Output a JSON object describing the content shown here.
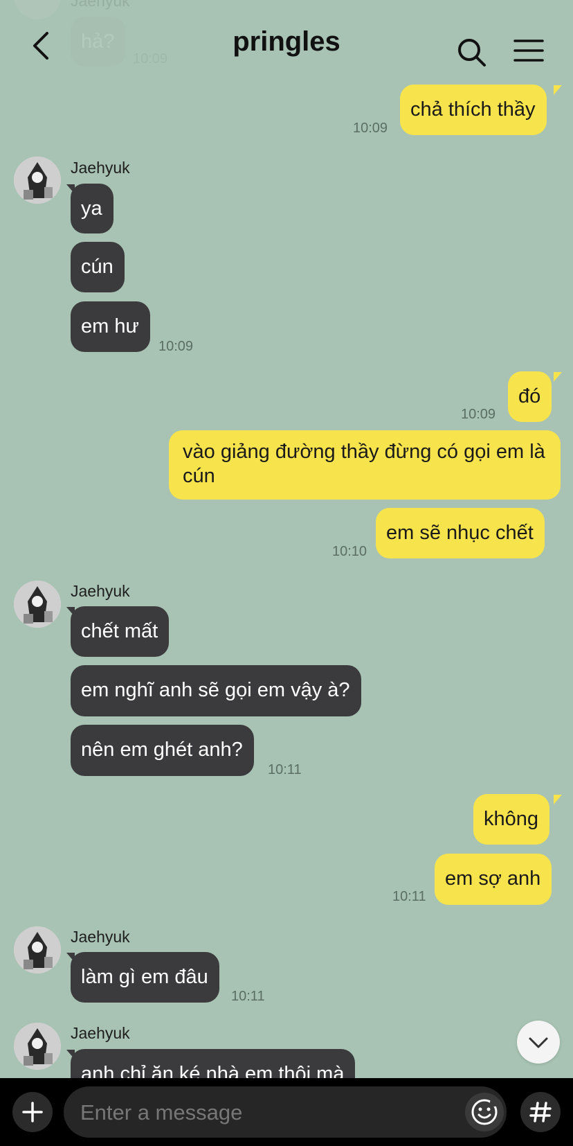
{
  "header": {
    "title": "pringles",
    "back_icon": "chevron-left-icon",
    "search_icon": "search-icon",
    "menu_icon": "hamburger-menu-icon"
  },
  "messages": {
    "faded_sender": "Jaehyuk",
    "faded_text": "hả?",
    "faded_time": "10:09",
    "m1": {
      "text": "chả thích thầy",
      "time": "10:09"
    },
    "g1": {
      "sender": "Jaehyuk",
      "a": "ya",
      "b": "cún",
      "c": "em hư",
      "time": "10:09"
    },
    "m2": {
      "a": "đó",
      "time_a": "10:09",
      "b": "vào giảng đường thầy đừng có gọi em là cún",
      "c": "em sẽ nhục chết",
      "time_c": "10:10"
    },
    "g2": {
      "sender": "Jaehyuk",
      "a": "chết mất",
      "b": "em nghĩ anh sẽ gọi em vậy à?",
      "c": "nên em ghét anh?",
      "time": "10:11"
    },
    "m3": {
      "a": "không",
      "b": "em sợ anh",
      "time": "10:11"
    },
    "g3": {
      "sender": "Jaehyuk",
      "a": "làm gì em đâu",
      "time": "10:11"
    },
    "g4": {
      "sender": "Jaehyuk",
      "a": "anh chỉ ăn ké nhà em thôi mà"
    }
  },
  "input": {
    "placeholder": "Enter a message",
    "plus_icon": "plus-icon",
    "emoji_icon": "emoji-icon",
    "hash_icon": "hashtag-icon"
  },
  "scroll_button_icon": "chevron-down-icon",
  "colors": {
    "background": "#a8c3b3",
    "my_bubble": "#f7e34b",
    "their_bubble": "#3b3b3d"
  }
}
